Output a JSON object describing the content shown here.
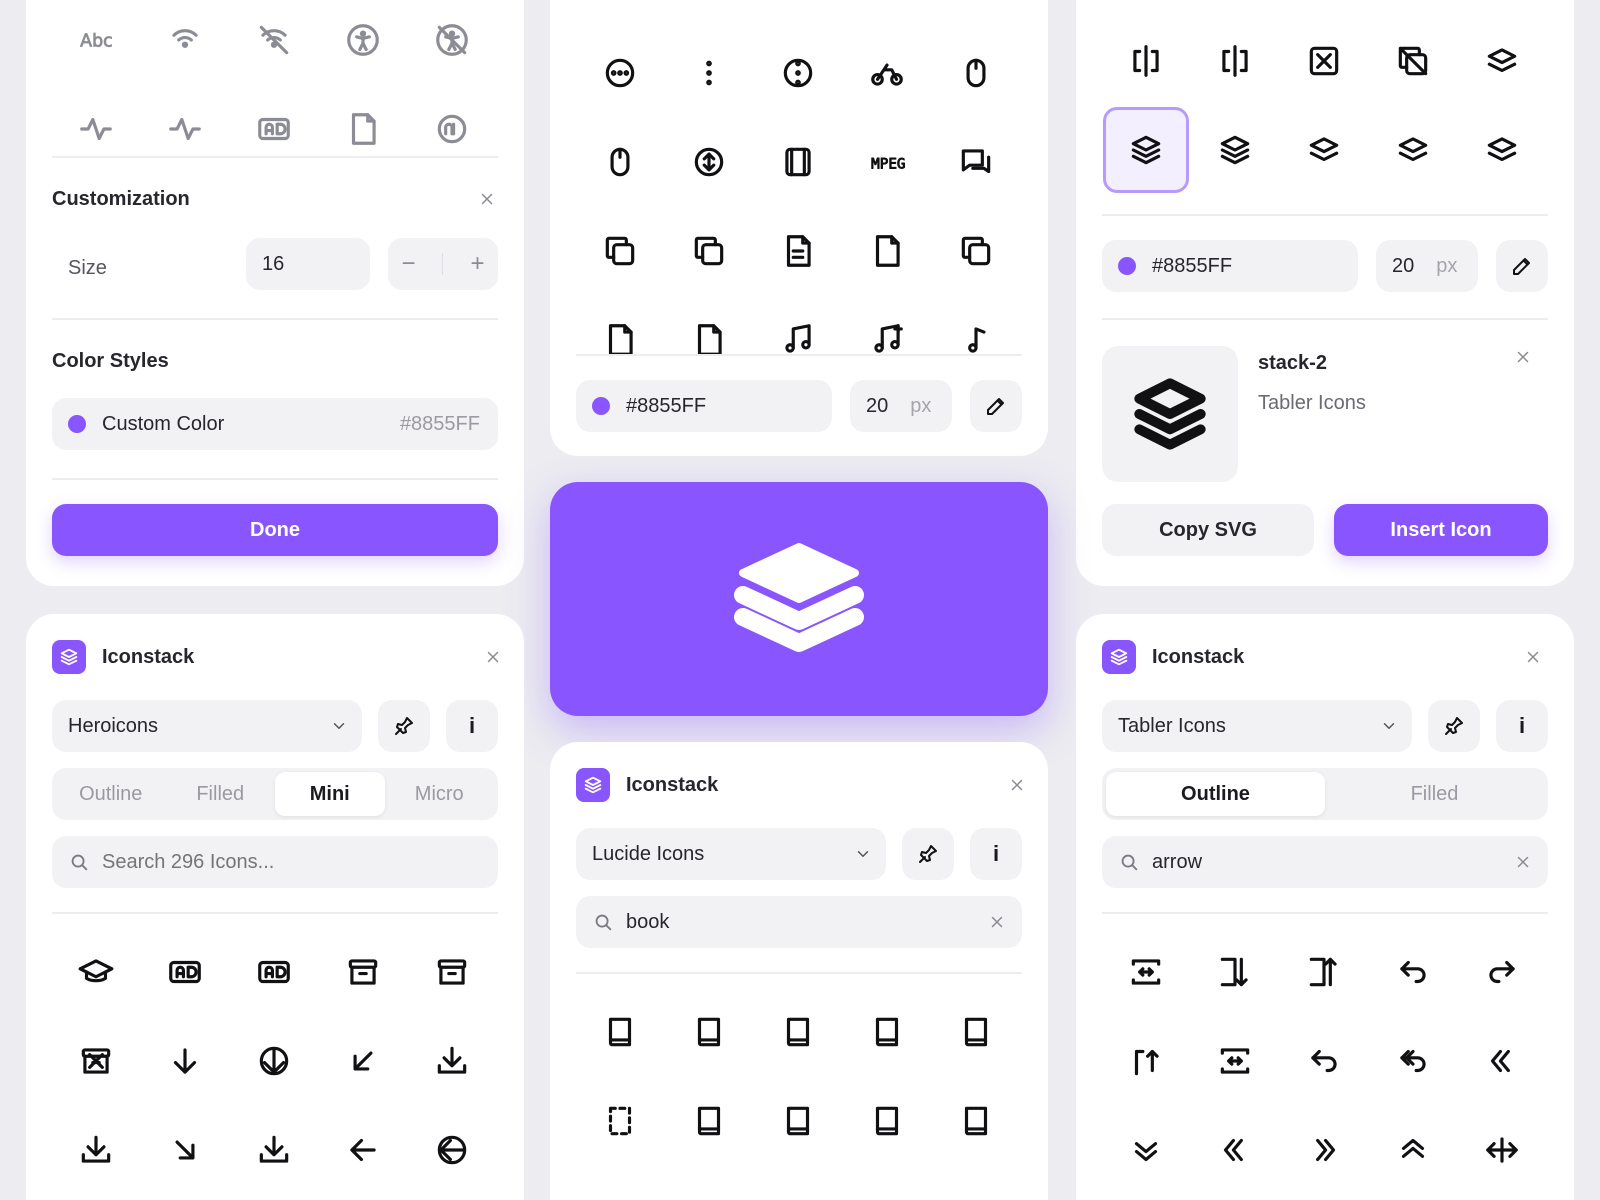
{
  "colors": {
    "accent": "#8855FF",
    "background": "#ECECF1",
    "card": "#FFFFFF"
  },
  "customization_panel": {
    "title": "Customization",
    "size_label": "Size",
    "size_value": "16",
    "minus": "−",
    "plus": "+",
    "color_styles_title": "Color Styles",
    "custom_color_label": "Custom Color",
    "custom_color_hex": "#8855FF",
    "done_label": "Done",
    "icons": [
      "text-abc-icon",
      "wifi-signal-icon",
      "wifi-off-icon",
      "accessibility-icon",
      "accessibility-off-icon",
      "activity-icon",
      "heartbeat-icon",
      "ad-icon",
      "ad-2-icon",
      "ad-circle-icon"
    ]
  },
  "top_center_panel": {
    "color_hex": "#8855FF",
    "size_value": "20",
    "size_unit": "px",
    "icons": [
      "circle-dots-icon",
      "dots-vertical-icon",
      "circle-dots-vertical-icon",
      "motorbike-icon",
      "mouse-icon",
      "mouse-2-icon",
      "mouse-scroll-icon",
      "movie-icon",
      "mpeg-icon",
      "messages-icon",
      "message-window-icon",
      "messages-window-icon",
      "file-text-icon",
      "copy-icon",
      "copy-2-icon",
      "file-music-icon",
      "file-music-2-icon",
      "music-icon",
      "music-plus-icon",
      "music-note-icon"
    ]
  },
  "top_right_panel": {
    "color_hex": "#8855FF",
    "size_value": "20",
    "size_unit": "px",
    "selected_name": "stack-2",
    "selected_library": "Tabler Icons",
    "copy_label": "Copy SVG",
    "insert_label": "Insert Icon",
    "icons": [
      "flip-vertical-icon",
      "flip-horizontal-icon",
      "square-x-icon",
      "copy-off-icon",
      "stack-icon",
      "stack-2-icon",
      "stack-3-icon",
      "stack-filled-icon",
      "stack-front-icon",
      "stack-back-icon"
    ]
  },
  "hero": {
    "icon": "stack-2-icon"
  },
  "heroicons_panel": {
    "app_name": "Iconstack",
    "library": "Heroicons",
    "tabs": [
      "Outline",
      "Filled",
      "Mini",
      "Micro"
    ],
    "active_tab": "Mini",
    "search_placeholder": "Search 296 Icons...",
    "icons": [
      "academic-cap-icon",
      "adjustments-horizontal-icon",
      "adjustments-vertical-icon",
      "archive-box-icon",
      "archive-box-arrow-down-icon",
      "archive-box-x-icon",
      "arrow-down-icon",
      "arrow-down-circle-icon",
      "arrow-down-left-icon",
      "arrow-down-on-square-icon",
      "arrow-down-on-square-stack-icon",
      "arrow-down-right-icon",
      "arrow-down-tray-icon",
      "arrow-left-icon",
      "arrow-left-circle-icon"
    ]
  },
  "lucide_panel": {
    "app_name": "Iconstack",
    "library": "Lucide Icons",
    "search_value": "book",
    "icons": [
      "book-icon",
      "book-a-icon",
      "book-audio-icon",
      "book-check-icon",
      "book-copy-icon",
      "book-dashed-icon",
      "book-down-icon",
      "book-headphones-icon",
      "book-heart-icon",
      "book-image-icon"
    ]
  },
  "tabler_panel": {
    "app_name": "Iconstack",
    "library": "Tabler Icons",
    "tabs": [
      "Outline",
      "Filled"
    ],
    "active_tab": "Outline",
    "search_value": "arrow",
    "icons": [
      "arrow-autofit-content-icon",
      "arrow-autofit-down-icon",
      "arrow-autofit-up-icon",
      "arrow-back-up-icon",
      "arrow-forward-up-icon",
      "arrow-bar-up-icon",
      "arrow-autofit-width-icon",
      "arrow-back-icon",
      "arrow-back-up-double-icon",
      "arrows-left-double-icon",
      "arrow-badge-down-icon",
      "arrow-badge-left-icon",
      "arrow-badge-right-icon",
      "arrow-badge-up-icon",
      "arrows-horizontal-icon"
    ]
  }
}
